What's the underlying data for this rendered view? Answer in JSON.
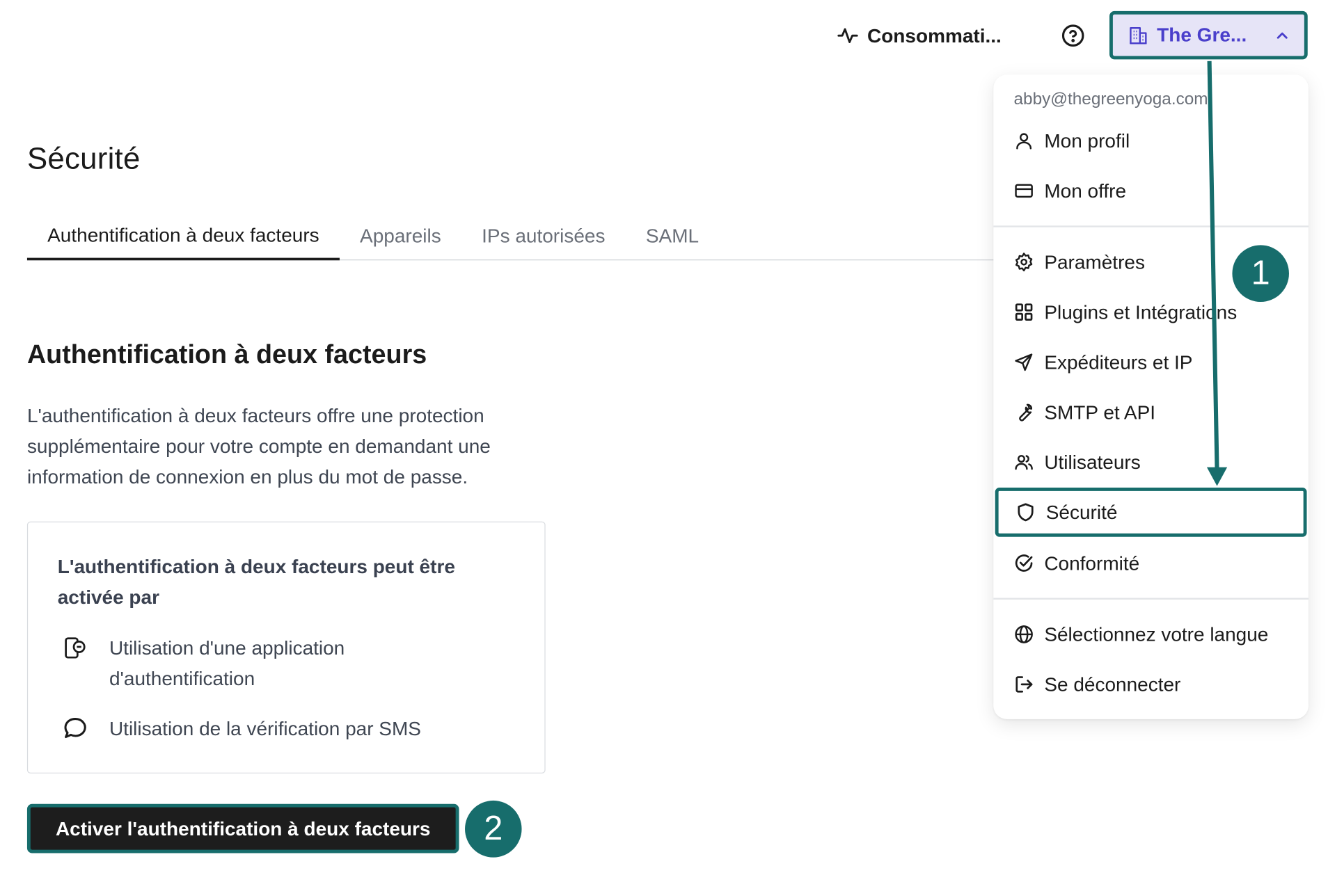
{
  "topbar": {
    "usage_label": "Consommati...",
    "account_name": "The Gre..."
  },
  "page": {
    "title": "Sécurité",
    "tabs": [
      {
        "label": "Authentification à deux facteurs"
      },
      {
        "label": "Appareils"
      },
      {
        "label": "IPs autorisées"
      },
      {
        "label": "SAML"
      }
    ]
  },
  "section": {
    "title": "Authentification à deux facteurs",
    "description": "L'authentification à deux facteurs offre une protection supplémentaire pour votre compte en demandant une information de connexion en plus du mot de passe.",
    "card_title": "L'authentification à deux facteurs peut être activée par",
    "methods": [
      {
        "label": "Utilisation d'une application d'authentification",
        "icon": "authenticator-app-icon"
      },
      {
        "label": "Utilisation de la vérification par SMS",
        "icon": "chat-bubble-icon"
      }
    ],
    "cta_label": "Activer l'authentification à deux facteurs"
  },
  "menu": {
    "email": "abby@thegreenyoga.com",
    "items": [
      {
        "label": "Mon profil",
        "icon": "user-icon"
      },
      {
        "label": "Mon offre",
        "icon": "credit-card-icon"
      },
      {
        "label": "Paramètres",
        "icon": "gear-icon"
      },
      {
        "label": "Plugins et Intégrations",
        "icon": "grid-icon"
      },
      {
        "label": "Expéditeurs et IP",
        "icon": "paper-plane-icon"
      },
      {
        "label": "SMTP et API",
        "icon": "wrench-icon"
      },
      {
        "label": "Utilisateurs",
        "icon": "users-icon"
      },
      {
        "label": "Sécurité",
        "icon": "shield-icon"
      },
      {
        "label": "Conformité",
        "icon": "check-circle-icon"
      },
      {
        "label": "Sélectionnez votre langue",
        "icon": "globe-icon"
      },
      {
        "label": "Se déconnecter",
        "icon": "logout-icon"
      }
    ]
  },
  "annotations": {
    "step1": "1",
    "step2": "2"
  },
  "colors": {
    "highlight": "#176d6c",
    "account_bg": "#e6e4f7",
    "account_text": "#4a3fcb"
  }
}
